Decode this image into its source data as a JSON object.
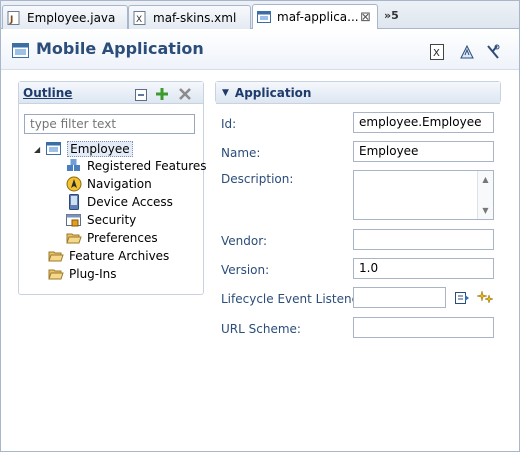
{
  "tabs": [
    {
      "label": "Employee.java",
      "icon": "java-file-icon"
    },
    {
      "label": "maf-skins.xml",
      "icon": "xml-file-icon"
    },
    {
      "label": "maf-applica...",
      "icon": "maf-application-icon",
      "close": "⊠"
    }
  ],
  "tab_overflow": "»5",
  "editor": {
    "title": "Mobile Application"
  },
  "outline": {
    "title": "Outline",
    "filter_placeholder": "type filter text",
    "tree": {
      "root": "Employee",
      "children": [
        "Registered Features",
        "Navigation",
        "Device Access",
        "Security",
        "Preferences"
      ],
      "siblings": [
        "Feature Archives",
        "Plug-Ins"
      ]
    }
  },
  "application": {
    "title": "Application",
    "fields": {
      "id": {
        "label": "Id:",
        "value": "employee.Employee"
      },
      "name": {
        "label": "Name:",
        "value": "Employee"
      },
      "description": {
        "label": "Description:",
        "value": ""
      },
      "vendor": {
        "label": "Vendor:",
        "value": ""
      },
      "version": {
        "label": "Version:",
        "value": "1.0"
      },
      "lifecycle": {
        "label": "Lifecycle Event Listener:",
        "value": ""
      },
      "url_scheme": {
        "label": "URL Scheme:",
        "value": ""
      }
    }
  },
  "colors": {
    "accent": "#2b4d7a",
    "tab_border": "#a7b6cb",
    "section_head": "#1e3b6b"
  }
}
